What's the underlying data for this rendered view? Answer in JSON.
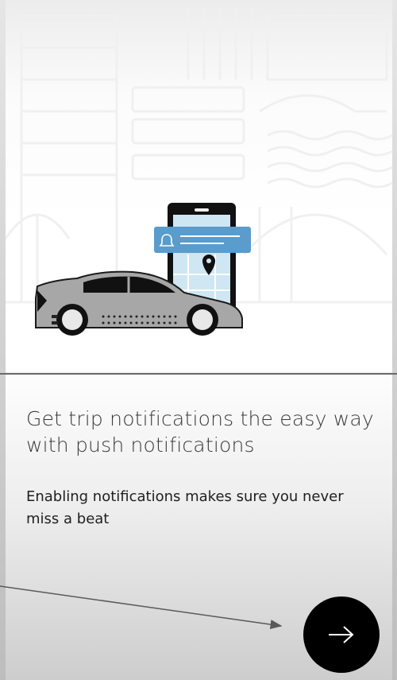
{
  "onboarding": {
    "title": "Get trip notifications the easy way with push notifications",
    "body": "Enabling notifications makes sure you never miss a beat"
  },
  "next_button": {
    "icon": "arrow-right-icon"
  },
  "colors": {
    "button_bg": "#000000",
    "notification_card": "#5a9ccb",
    "car_body": "#a7a7a7",
    "phone_body": "#111111",
    "map_bg": "#cfe6f3"
  }
}
